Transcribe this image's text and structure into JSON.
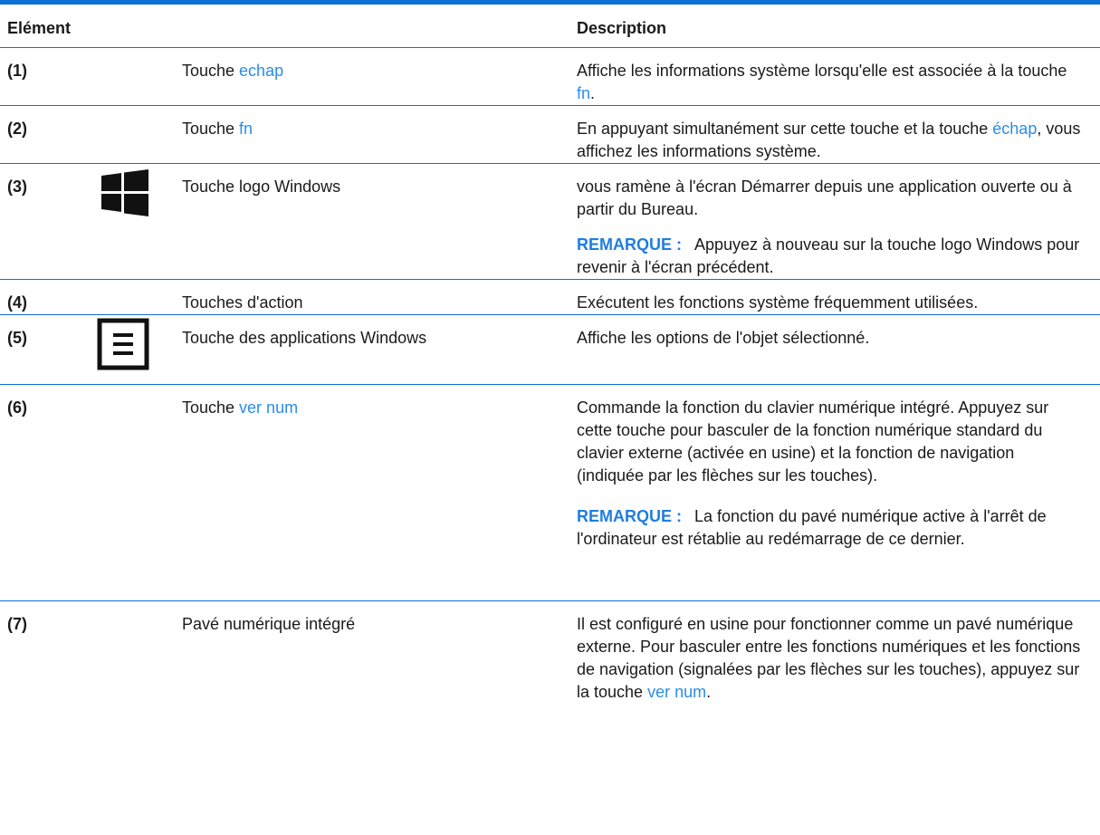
{
  "header": {
    "col_element": "Elément",
    "col_description": "Description"
  },
  "rows": [
    {
      "num": "(1)",
      "name_pre": "Touche ",
      "name_link": "echap",
      "desc_pre": "Affiche les informations système lorsqu'elle est associée à la touche ",
      "desc_link": "fn",
      "desc_post": "."
    },
    {
      "num": "(2)",
      "name_pre": "Touche ",
      "name_link": "fn",
      "desc_pre": "En appuyant simultanément sur cette touche et la touche ",
      "desc_link": "échap",
      "desc_post": ", vous affichez les informations système."
    },
    {
      "num": "(3)",
      "icon": "windows-logo-icon",
      "name": "Touche logo Windows",
      "desc": "vous ramène à l'écran Démarrer depuis une application ouverte ou à partir du Bureau.",
      "note_label": "REMARQUE :",
      "note_text": "Appuyez à nouveau sur la touche logo Windows pour revenir à l'écran précédent."
    },
    {
      "num": "(4)",
      "name": "Touches d'action",
      "desc": "Exécutent les fonctions système fréquemment utilisées."
    },
    {
      "num": "(5)",
      "icon": "applications-menu-icon",
      "name": "Touche des applications Windows",
      "desc": "Affiche les options de l'objet sélectionné."
    },
    {
      "num": "(6)",
      "name_pre": "Touche ",
      "name_link": "ver num",
      "desc": "Commande la fonction du clavier numérique intégré. Appuyez sur cette touche pour basculer de la fonction numérique standard du clavier externe (activée en usine) et la fonction de navigation (indiquée par les flèches sur les touches).",
      "note_label": "REMARQUE :",
      "note_text": "La fonction du pavé numérique active à l'arrêt de l'ordinateur est rétablie au redémarrage de ce dernier."
    },
    {
      "num": "(7)",
      "name": "Pavé numérique intégré",
      "desc_pre": "Il est configuré en usine pour fonctionner comme un pavé numérique externe. Pour basculer entre les fonctions numériques et les fonctions de navigation (signalées par les flèches sur les touches), appuyez sur la touche ",
      "desc_link": "ver num",
      "desc_post": "."
    }
  ],
  "colors": {
    "rule": "#0b6fd4",
    "note_label": "#1f7de0",
    "link": "#2a8de8"
  }
}
